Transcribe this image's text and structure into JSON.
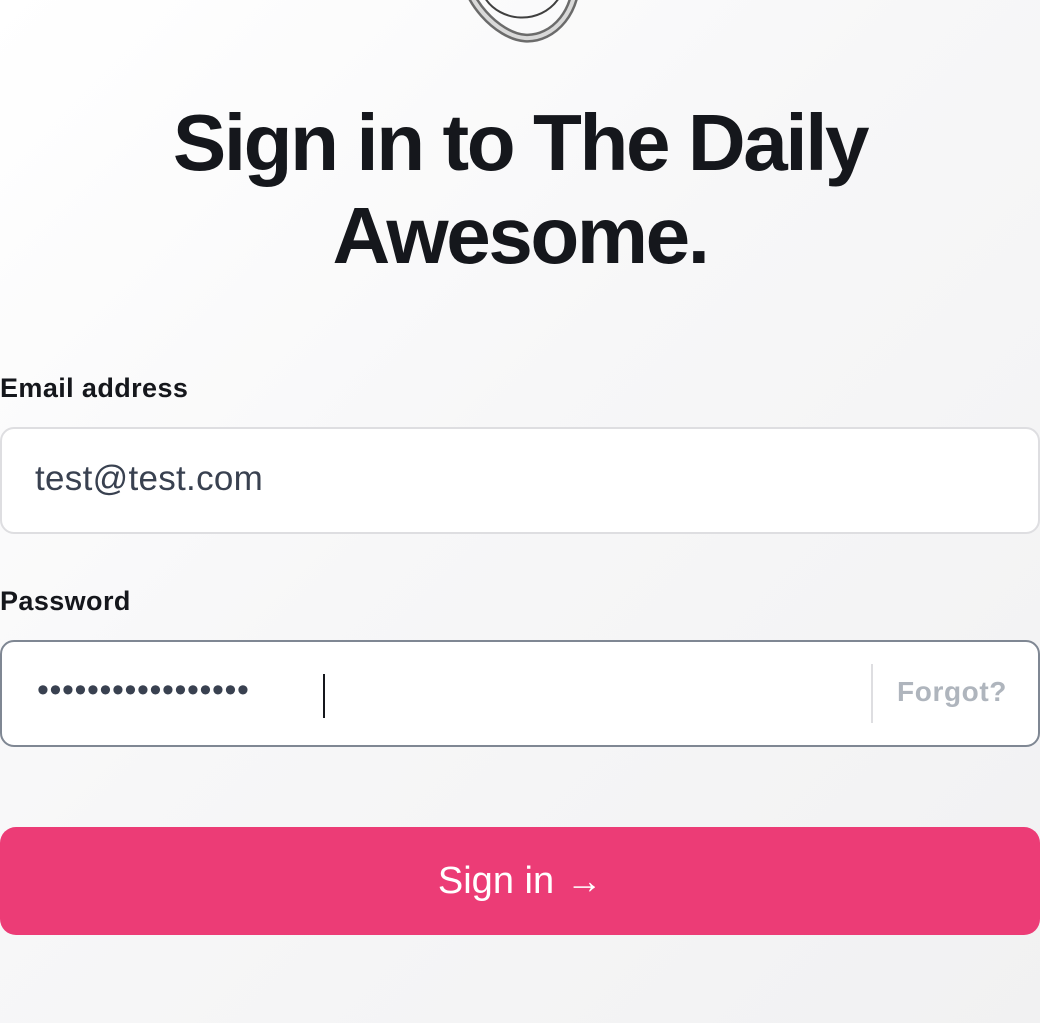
{
  "logo": {
    "icon": "ring-logo-icon"
  },
  "heading": {
    "title": "Sign in to The Daily Awesome."
  },
  "email": {
    "label": "Email address",
    "value": "test@test.com"
  },
  "password": {
    "label": "Password",
    "masked_value": "•••••••••••••••••",
    "forgot_label": "Forgot?"
  },
  "signin": {
    "label": "Sign in",
    "arrow": "→",
    "color": "#ec3c76"
  }
}
